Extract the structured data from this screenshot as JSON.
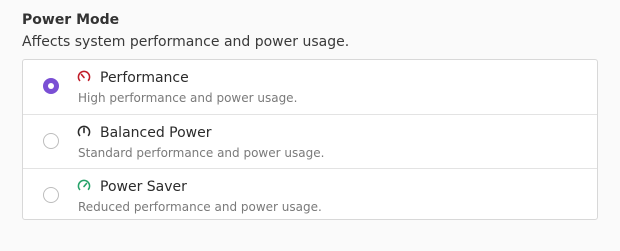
{
  "power_mode": {
    "title": "Power Mode",
    "description": "Affects system performance and power usage.",
    "options": [
      {
        "label": "Performance",
        "description": "High performance and power usage.",
        "icon": "speedometer-high-icon",
        "icon_color": "#c01c28",
        "selected": true
      },
      {
        "label": "Balanced Power",
        "description": "Standard performance and power usage.",
        "icon": "speedometer-medium-icon",
        "icon_color": "#2b2b2b",
        "selected": false
      },
      {
        "label": "Power Saver",
        "description": "Reduced performance and power usage.",
        "icon": "speedometer-low-icon",
        "icon_color": "#26a269",
        "selected": false
      }
    ],
    "accent_color": "#7a4fd4"
  }
}
